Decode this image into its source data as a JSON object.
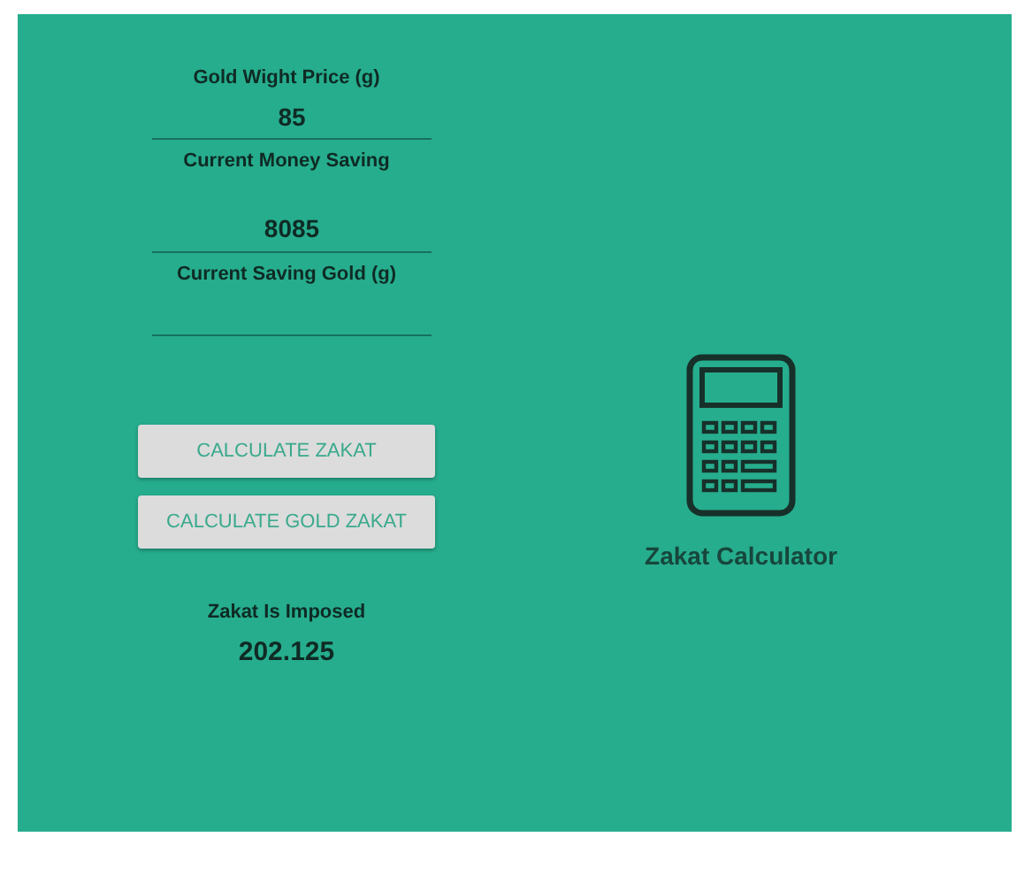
{
  "fields": [
    {
      "label": "Gold Wight Price (g)",
      "value": "85"
    },
    {
      "label": "Current Money Saving",
      "value": "8085"
    },
    {
      "label": "Current Saving Gold (g)"
    }
  ],
  "buttons": [
    "CALCULATE ZAKAT",
    "CALCULATE GOLD ZAKAT"
  ],
  "result": {
    "label": "Zakat Is Imposed",
    "value": "202.125"
  },
  "app_title": "Zakat Calculator"
}
